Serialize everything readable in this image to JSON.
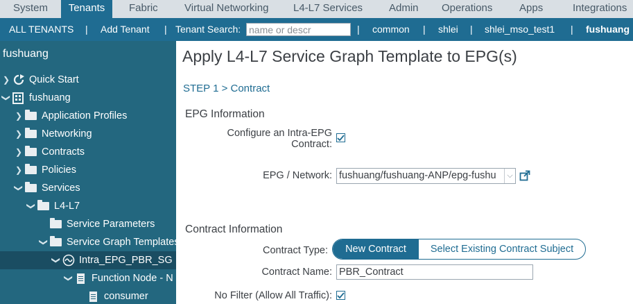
{
  "top_menu": {
    "items": [
      "System",
      "Tenants",
      "Fabric",
      "Virtual Networking",
      "L4-L7 Services",
      "Admin",
      "Operations",
      "Apps",
      "Integrations"
    ],
    "active": "Tenants"
  },
  "sub_menu": {
    "all_tenants": "ALL TENANTS",
    "add_tenant": "Add Tenant",
    "search_label": "Tenant Search:",
    "search_placeholder": "name or descr",
    "tenants": [
      "common",
      "shlei",
      "shlei_mso_test1",
      "fushuang"
    ],
    "separator": "|"
  },
  "sidebar": {
    "title": "fushuang",
    "tree": [
      {
        "label": "Quick Start",
        "icon": "quick-start-icon",
        "expanded": false
      },
      {
        "label": "fushuang",
        "icon": "tenant-building-icon",
        "expanded": true
      },
      {
        "label": "Application Profiles",
        "icon": "folder-icon",
        "expanded": false
      },
      {
        "label": "Networking",
        "icon": "folder-icon",
        "expanded": false
      },
      {
        "label": "Contracts",
        "icon": "folder-icon",
        "expanded": false
      },
      {
        "label": "Policies",
        "icon": "folder-icon",
        "expanded": false
      },
      {
        "label": "Services",
        "icon": "folder-icon",
        "expanded": true
      },
      {
        "label": "L4-L7",
        "icon": "folder-icon",
        "expanded": true
      },
      {
        "label": "Service Parameters",
        "icon": "folder-icon",
        "expanded": false
      },
      {
        "label": "Service Graph Templates",
        "icon": "folder-icon",
        "expanded": true
      },
      {
        "label": "Intra_EPG_PBR_SG",
        "icon": "service-graph-icon",
        "expanded": true,
        "selected": true
      },
      {
        "label": "Function Node - N",
        "icon": "document-icon",
        "expanded": true
      },
      {
        "label": "consumer",
        "icon": "document-icon",
        "expanded": false
      }
    ]
  },
  "content": {
    "title": "Apply L4-L7 Service Graph Template to EPG(s)",
    "step": "STEP 1 > Contract",
    "epg_section": "EPG Information",
    "intra_epg_label_1": "Configure an Intra-EPG",
    "intra_epg_label_2": "Contract:",
    "intra_epg_checked": true,
    "epg_network_label": "EPG / Network:",
    "epg_network_value": "fushuang/fushuang-ANP/epg-fushu",
    "contract_section": "Contract Information",
    "contract_type_label": "Contract Type:",
    "contract_type_options": [
      "New Contract",
      "Select Existing Contract Subject"
    ],
    "contract_type_selected": "New Contract",
    "contract_name_label": "Contract Name:",
    "contract_name_value": "PBR_Contract",
    "no_filter_label": "No Filter (Allow All Traffic):",
    "no_filter_checked": true
  },
  "colors": {
    "brand_blue": "#1f6c92",
    "sidebar_bg": "#23677f",
    "top_menu_bg": "#d9dfe4"
  }
}
